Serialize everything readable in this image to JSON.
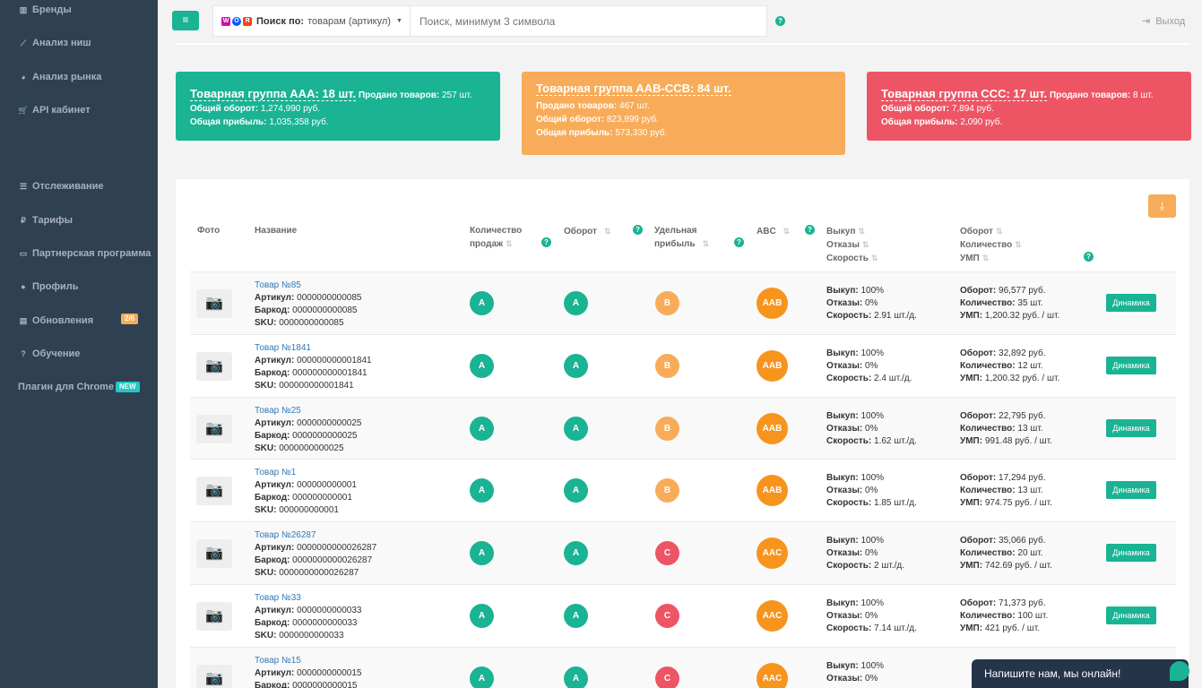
{
  "sidebar": {
    "items": [
      {
        "label": "Бренды",
        "icon": "bar-chart-icon"
      },
      {
        "label": "Анализ ниш",
        "icon": "line-chart-icon"
      },
      {
        "label": "Анализ рынка",
        "icon": "pie-chart-icon"
      },
      {
        "label": "API кабинет",
        "icon": "cart-icon"
      },
      {
        "label": "Отслеживание",
        "icon": "list-icon"
      },
      {
        "label": "Тарифы",
        "icon": "ruble-icon"
      },
      {
        "label": "Партнерская программа",
        "icon": "card-icon"
      },
      {
        "label": "Профиль",
        "icon": "user-icon"
      },
      {
        "label": "Обновления",
        "icon": "news-icon",
        "badge": "2/6"
      },
      {
        "label": "Обучение",
        "icon": "question-icon"
      },
      {
        "label": "Плагин для Chrome",
        "badge": "NEW"
      }
    ]
  },
  "header": {
    "search_by_label": "Поиск по:",
    "search_by_value": "товарам (артикул)",
    "search_placeholder": "Поиск, минимум 3 символа",
    "help": "?",
    "logout": "Выход",
    "marketplace_icons": [
      "W",
      "O",
      "Я"
    ]
  },
  "cards": [
    {
      "color": "#1ab394",
      "title": "Товарная группа AAA: 18 шт.",
      "sold_label": "Продано товаров:",
      "sold_value": "257 шт.",
      "turnover_label": "Общий оборот:",
      "turnover_value": "1,274,990 руб.",
      "profit_label": "Общая прибыль:",
      "profit_value": "1,035,358 руб."
    },
    {
      "color": "#f8ac59",
      "title": "Товарная группа AAB-CCB: 84 шт.",
      "sold_label": "Продано товаров:",
      "sold_value": "467 шт.",
      "turnover_label": "Общий оборот:",
      "turnover_value": "823,899 руб.",
      "profit_label": "Общая прибыль:",
      "profit_value": "573,330 руб."
    },
    {
      "color": "#ed5565",
      "title": "Товарная группа CCC: 17 шт.",
      "sold_label": "Продано товаров:",
      "sold_value": "8 шт.",
      "turnover_label": "Общий оборот:",
      "turnover_value": "7,894 руб.",
      "profit_label": "Общая прибыль:",
      "profit_value": "2,090 руб."
    }
  ],
  "table": {
    "headers": {
      "photo": "Фото",
      "name": "Название",
      "qty1": "Количество",
      "qty2": "продаж",
      "turnover": "Оборот",
      "profit1": "Удельная",
      "profit2": "прибыль",
      "abc": "ABC",
      "buyout": "Выкуп",
      "refusals": "Отказы",
      "speed": "Скорость",
      "t_turnover": "Оборот",
      "t_qty": "Количество",
      "t_ump": "УМП"
    },
    "labels": {
      "article": "Артикул:",
      "barcode": "Баркод:",
      "sku": "SKU:",
      "buyout": "Выкуп:",
      "refusals": "Отказы:",
      "speed": "Скорость:",
      "turnover": "Оборот:",
      "qty": "Количество:",
      "ump": "УМП:",
      "dynamics": "Динамика"
    },
    "rows": [
      {
        "name": "Товар №85",
        "article": "0000000000085",
        "barcode": "0000000000085",
        "sku": "0000000000085",
        "qty": "A",
        "turnover": "A",
        "profit": "B",
        "abc": "AAB",
        "buyout": "100%",
        "refusals": "0%",
        "speed": "2.91 шт./д.",
        "t_turnover": "96,577 руб.",
        "t_qty": "35 шт.",
        "t_ump": "1,200.32 руб. / шт."
      },
      {
        "name": "Товар №1841",
        "article": "000000000001841",
        "barcode": "000000000001841",
        "sku": "000000000001841",
        "qty": "A",
        "turnover": "A",
        "profit": "B",
        "abc": "AAB",
        "buyout": "100%",
        "refusals": "0%",
        "speed": "2.4 шт./д.",
        "t_turnover": "32,892 руб.",
        "t_qty": "12 шт.",
        "t_ump": "1,200.32 руб. / шт."
      },
      {
        "name": "Товар №25",
        "article": "0000000000025",
        "barcode": "0000000000025",
        "sku": "0000000000025",
        "qty": "A",
        "turnover": "A",
        "profit": "B",
        "abc": "AAB",
        "buyout": "100%",
        "refusals": "0%",
        "speed": "1.62 шт./д.",
        "t_turnover": "22,795 руб.",
        "t_qty": "13 шт.",
        "t_ump": "991.48 руб. / шт."
      },
      {
        "name": "Товар №1",
        "article": "000000000001",
        "barcode": "000000000001",
        "sku": "000000000001",
        "qty": "A",
        "turnover": "A",
        "profit": "B",
        "abc": "AAB",
        "buyout": "100%",
        "refusals": "0%",
        "speed": "1.85 шт./д.",
        "t_turnover": "17,294 руб.",
        "t_qty": "13 шт.",
        "t_ump": "974.75 руб. / шт."
      },
      {
        "name": "Товар №26287",
        "article": "0000000000026287",
        "barcode": "0000000000026287",
        "sku": "0000000000026287",
        "qty": "A",
        "turnover": "A",
        "profit": "C",
        "abc": "AAC",
        "buyout": "100%",
        "refusals": "0%",
        "speed": "2 шт./д.",
        "t_turnover": "35,066 руб.",
        "t_qty": "20 шт.",
        "t_ump": "742.69 руб. / шт."
      },
      {
        "name": "Товар №33",
        "article": "0000000000033",
        "barcode": "0000000000033",
        "sku": "0000000000033",
        "qty": "A",
        "turnover": "A",
        "profit": "C",
        "abc": "AAC",
        "buyout": "100%",
        "refusals": "0%",
        "speed": "7.14 шт./д.",
        "t_turnover": "71,373 руб.",
        "t_qty": "100 шт.",
        "t_ump": "421 руб. / шт."
      },
      {
        "name": "Товар №15",
        "article": "0000000000015",
        "barcode": "0000000000015",
        "sku": "",
        "qty": "A",
        "turnover": "A",
        "profit": "C",
        "abc": "AAC",
        "buyout": "100%",
        "refusals": "0%",
        "speed": "",
        "t_turnover": "",
        "t_qty": "",
        "t_ump": ""
      }
    ]
  },
  "chat": {
    "label": "Напишите нам, мы онлайн!"
  },
  "colors": {
    "green": "#1ab394",
    "orange": "#f8ac59",
    "red": "#ed5565",
    "abc_orange": "#f7941d",
    "sidebar": "#2f4050"
  }
}
